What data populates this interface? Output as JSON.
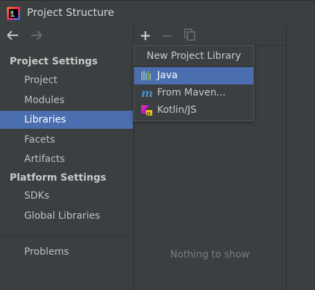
{
  "window": {
    "title": "Project Structure"
  },
  "sidebar": {
    "project_settings_header": "Project Settings",
    "project_settings_items": [
      "Project",
      "Modules",
      "Libraries",
      "Facets",
      "Artifacts"
    ],
    "selected_item": "Libraries",
    "platform_settings_header": "Platform Settings",
    "platform_settings_items": [
      "SDKs",
      "Global Libraries"
    ],
    "problems_item": "Problems"
  },
  "toolbar": {
    "add_label": "+",
    "remove_label": "−"
  },
  "popup": {
    "title": "New Project Library",
    "items": [
      {
        "label": "Java",
        "icon": "java-library-icon",
        "selected": true
      },
      {
        "label": "From Maven...",
        "icon": "maven-icon",
        "selected": false
      },
      {
        "label": "Kotlin/JS",
        "icon": "kotlin-js-icon",
        "selected": false
      }
    ]
  },
  "main": {
    "empty_text": "Nothing to show"
  },
  "colors": {
    "background": "#3c3f41",
    "selection": "#4b6eaf",
    "text": "#bbbbbb",
    "muted": "#7a7d7f"
  },
  "icons": {
    "back": "arrow-left-icon",
    "forward": "arrow-right-icon",
    "copy": "copy-icon",
    "app": "intellij-idea-icon"
  }
}
